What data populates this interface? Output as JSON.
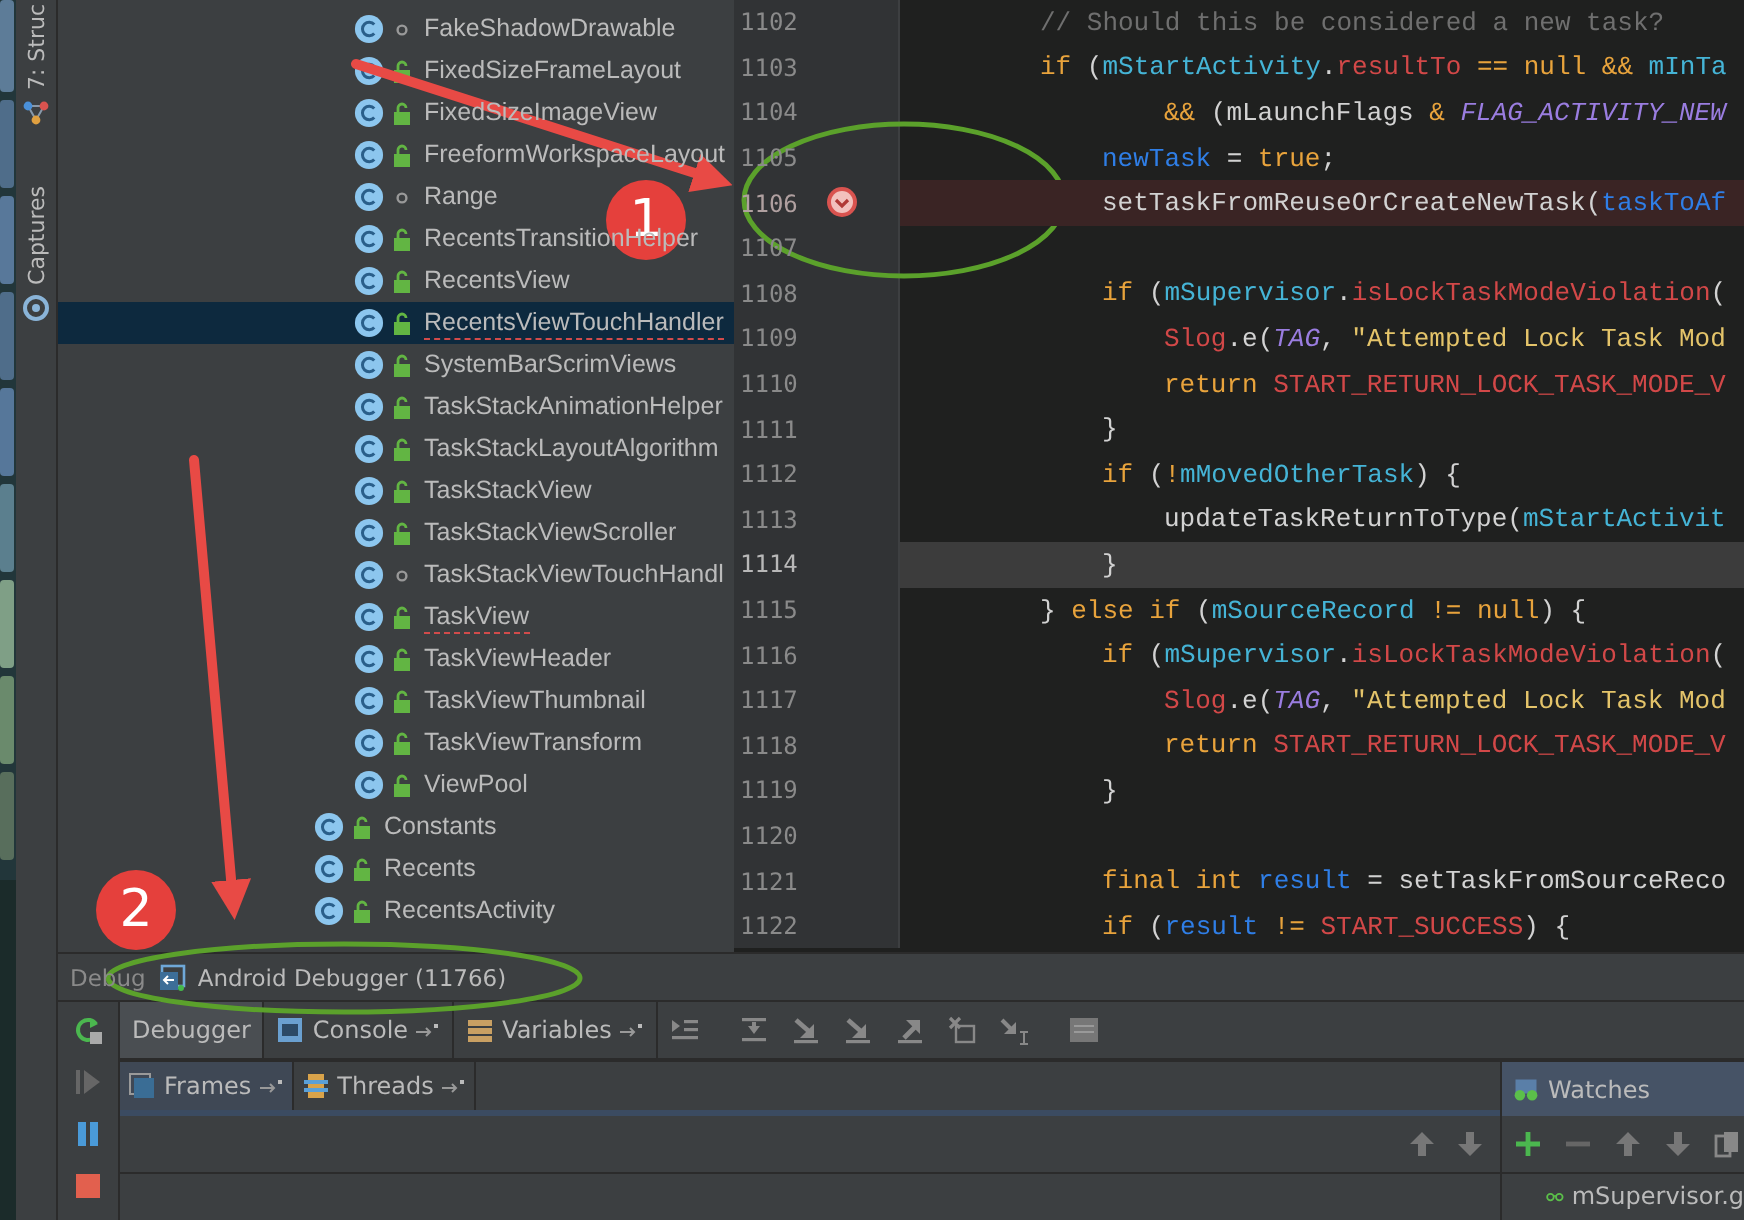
{
  "tool_strip": {
    "items": [
      {
        "label": "7: Struc"
      },
      {
        "label": "Captures"
      }
    ]
  },
  "tree": {
    "nested_items": [
      {
        "label": "FakeShadowDrawable",
        "public": false,
        "selected": false,
        "error": false
      },
      {
        "label": "FixedSizeFrameLayout",
        "public": true,
        "selected": false,
        "error": false
      },
      {
        "label": "FixedSizeImageView",
        "public": true,
        "selected": false,
        "error": false
      },
      {
        "label": "FreeformWorkspaceLayout",
        "public": true,
        "selected": false,
        "error": false
      },
      {
        "label": "Range",
        "public": false,
        "selected": false,
        "error": false
      },
      {
        "label": "RecentsTransitionHelper",
        "public": true,
        "selected": false,
        "error": false
      },
      {
        "label": "RecentsView",
        "public": true,
        "selected": false,
        "error": false
      },
      {
        "label": "RecentsViewTouchHandler",
        "public": true,
        "selected": true,
        "error": true
      },
      {
        "label": "SystemBarScrimViews",
        "public": true,
        "selected": false,
        "error": false
      },
      {
        "label": "TaskStackAnimationHelper",
        "public": true,
        "selected": false,
        "error": false
      },
      {
        "label": "TaskStackLayoutAlgorithm",
        "public": true,
        "selected": false,
        "error": false
      },
      {
        "label": "TaskStackView",
        "public": true,
        "selected": false,
        "error": false
      },
      {
        "label": "TaskStackViewScroller",
        "public": true,
        "selected": false,
        "error": false
      },
      {
        "label": "TaskStackViewTouchHandl",
        "public": false,
        "selected": false,
        "error": false
      },
      {
        "label": "TaskView",
        "public": true,
        "selected": false,
        "error": true
      },
      {
        "label": "TaskViewHeader",
        "public": true,
        "selected": false,
        "error": false
      },
      {
        "label": "TaskViewThumbnail",
        "public": true,
        "selected": false,
        "error": false
      },
      {
        "label": "TaskViewTransform",
        "public": true,
        "selected": false,
        "error": false
      },
      {
        "label": "ViewPool",
        "public": true,
        "selected": false,
        "error": false
      }
    ],
    "items": [
      {
        "label": "Constants",
        "public": true,
        "selected": false,
        "error": false
      },
      {
        "label": "Recents",
        "public": true,
        "selected": false,
        "error": false
      },
      {
        "label": "RecentsActivity",
        "public": true,
        "selected": false,
        "error": false
      }
    ]
  },
  "editor": {
    "lines": [
      {
        "number": "1102",
        "kind": "top",
        "breakpoint": false,
        "current": false,
        "tokens": [
          {
            "kind": "comment",
            "text": "// Should this be considered a new task?"
          }
        ]
      },
      {
        "number": "1103",
        "kind": "top",
        "breakpoint": false,
        "current": false,
        "tokens": [
          {
            "kind": "keyword",
            "text": "if "
          },
          {
            "kind": "plain",
            "text": "("
          },
          {
            "kind": "field",
            "text": "mStartActivity"
          },
          {
            "kind": "plain",
            "text": "."
          },
          {
            "kind": "member",
            "text": "resultTo "
          },
          {
            "kind": "keyword",
            "text": "== "
          },
          {
            "kind": "keyword",
            "text": "null "
          },
          {
            "kind": "keyword",
            "text": "&& "
          },
          {
            "kind": "field",
            "text": "mInTa"
          }
        ]
      },
      {
        "number": "1104",
        "kind": "deep",
        "breakpoint": false,
        "current": false,
        "tokens": [
          {
            "kind": "keyword",
            "text": "&& "
          },
          {
            "kind": "plain",
            "text": "(mLaunchFlags "
          },
          {
            "kind": "keyword",
            "text": "& "
          },
          {
            "kind": "constant",
            "text": "FLAG_ACTIVITY_NEW"
          }
        ]
      },
      {
        "number": "1105",
        "kind": "nested",
        "breakpoint": false,
        "current": false,
        "tokens": [
          {
            "kind": "local",
            "text": "newTask "
          },
          {
            "kind": "plain",
            "text": "= "
          },
          {
            "kind": "keyword",
            "text": "true"
          },
          {
            "kind": "plain",
            "text": ";"
          }
        ]
      },
      {
        "number": "1106",
        "kind": "nested",
        "breakpoint": true,
        "current": false,
        "tokens": [
          {
            "kind": "plain",
            "text": "setTaskFromReuseOrCreateNewTask("
          },
          {
            "kind": "local",
            "text": "taskToAf"
          }
        ]
      },
      {
        "number": "1107",
        "breakpoint": false,
        "current": false
      },
      {
        "number": "1108",
        "kind": "nested",
        "breakpoint": false,
        "current": false,
        "tokens": [
          {
            "kind": "keyword",
            "text": "if "
          },
          {
            "kind": "plain",
            "text": "("
          },
          {
            "kind": "field",
            "text": "mSupervisor"
          },
          {
            "kind": "plain",
            "text": "."
          },
          {
            "kind": "member",
            "text": "isLockTaskModeViolation"
          },
          {
            "kind": "plain",
            "text": "("
          }
        ]
      },
      {
        "number": "1109",
        "kind": "deep",
        "breakpoint": false,
        "current": false,
        "tokens": [
          {
            "kind": "member",
            "text": "Slog"
          },
          {
            "kind": "plain",
            "text": ".e("
          },
          {
            "kind": "constant",
            "text": "TAG"
          },
          {
            "kind": "plain",
            "text": ", "
          },
          {
            "kind": "string",
            "text": "\"Attempted Lock Task Mod"
          }
        ]
      },
      {
        "number": "1110",
        "kind": "deep",
        "breakpoint": false,
        "current": false,
        "tokens": [
          {
            "kind": "keyword",
            "text": "return "
          },
          {
            "kind": "member",
            "text": "START_RETURN_LOCK_TASK_MODE_V"
          }
        ]
      },
      {
        "number": "1111",
        "kind": "nested",
        "breakpoint": false,
        "current": false,
        "tokens": [
          {
            "kind": "plain",
            "text": "}"
          }
        ]
      },
      {
        "number": "1112",
        "kind": "nested",
        "breakpoint": false,
        "current": false,
        "tokens": [
          {
            "kind": "keyword",
            "text": "if "
          },
          {
            "kind": "plain",
            "text": "("
          },
          {
            "kind": "keyword",
            "text": "!"
          },
          {
            "kind": "field",
            "text": "mMovedOtherTask"
          },
          {
            "kind": "plain",
            "text": ") {"
          }
        ]
      },
      {
        "number": "1113",
        "kind": "deep",
        "breakpoint": false,
        "current": false,
        "tokens": [
          {
            "kind": "plain",
            "text": "updateTaskReturnToType("
          },
          {
            "kind": "field",
            "text": "mStartActivit"
          }
        ]
      },
      {
        "number": "1114",
        "kind": "nested",
        "breakpoint": false,
        "current": true,
        "tokens": [
          {
            "kind": "plain",
            "text": "}"
          }
        ]
      },
      {
        "number": "1115",
        "kind": "top",
        "breakpoint": false,
        "current": false,
        "tokens": [
          {
            "kind": "plain",
            "text": "} "
          },
          {
            "kind": "keyword",
            "text": "else if "
          },
          {
            "kind": "plain",
            "text": "("
          },
          {
            "kind": "field",
            "text": "mSourceRecord "
          },
          {
            "kind": "keyword",
            "text": "!= "
          },
          {
            "kind": "keyword",
            "text": "null"
          },
          {
            "kind": "plain",
            "text": ") {"
          }
        ]
      },
      {
        "number": "1116",
        "kind": "nested",
        "breakpoint": false,
        "current": false,
        "tokens": [
          {
            "kind": "keyword",
            "text": "if "
          },
          {
            "kind": "plain",
            "text": "("
          },
          {
            "kind": "field",
            "text": "mSupervisor"
          },
          {
            "kind": "plain",
            "text": "."
          },
          {
            "kind": "member",
            "text": "isLockTaskModeViolation"
          },
          {
            "kind": "plain",
            "text": "("
          }
        ]
      },
      {
        "number": "1117",
        "kind": "deep",
        "breakpoint": false,
        "current": false,
        "tokens": [
          {
            "kind": "member",
            "text": "Slog"
          },
          {
            "kind": "plain",
            "text": ".e("
          },
          {
            "kind": "constant",
            "text": "TAG"
          },
          {
            "kind": "plain",
            "text": ", "
          },
          {
            "kind": "string",
            "text": "\"Attempted Lock Task Mod"
          }
        ]
      },
      {
        "number": "1118",
        "kind": "deep",
        "breakpoint": false,
        "current": false,
        "tokens": [
          {
            "kind": "keyword",
            "text": "return "
          },
          {
            "kind": "member",
            "text": "START_RETURN_LOCK_TASK_MODE_V"
          }
        ]
      },
      {
        "number": "1119",
        "kind": "nested",
        "breakpoint": false,
        "current": false,
        "tokens": [
          {
            "kind": "plain",
            "text": "}"
          }
        ]
      },
      {
        "number": "1120",
        "breakpoint": false,
        "current": false
      },
      {
        "number": "1121",
        "kind": "nested",
        "breakpoint": false,
        "current": false,
        "tokens": [
          {
            "kind": "keyword",
            "text": "final int "
          },
          {
            "kind": "local",
            "text": "result "
          },
          {
            "kind": "plain",
            "text": "= setTaskFromSourceReco"
          }
        ]
      },
      {
        "number": "1122",
        "kind": "nested",
        "breakpoint": false,
        "current": false,
        "tokens": [
          {
            "kind": "keyword",
            "text": "if "
          },
          {
            "kind": "plain",
            "text": "("
          },
          {
            "kind": "local",
            "text": "result "
          },
          {
            "kind": "keyword",
            "text": "!= "
          },
          {
            "kind": "member",
            "text": "START_SUCCESS"
          },
          {
            "kind": "plain",
            "text": ") {"
          }
        ]
      }
    ]
  },
  "debug": {
    "title": "Debug",
    "session": "Android Debugger (11766)",
    "tabs": [
      {
        "label": "Debugger",
        "kind": "debugger",
        "selected": true,
        "pinned": false
      },
      {
        "label": "Console",
        "kind": "console",
        "selected": false,
        "pinned": true
      },
      {
        "label": "Variables",
        "kind": "variables",
        "selected": false,
        "pinned": true
      }
    ],
    "subtabs": [
      {
        "label": "Frames",
        "kind": "frames",
        "selected": true
      },
      {
        "label": "Threads",
        "kind": "threads",
        "selected": false
      }
    ],
    "watches": {
      "title": "Watches",
      "items": [
        "mSupervisor.g"
      ]
    }
  },
  "annotations": [
    {
      "label": "1"
    },
    {
      "label": "2"
    }
  ]
}
